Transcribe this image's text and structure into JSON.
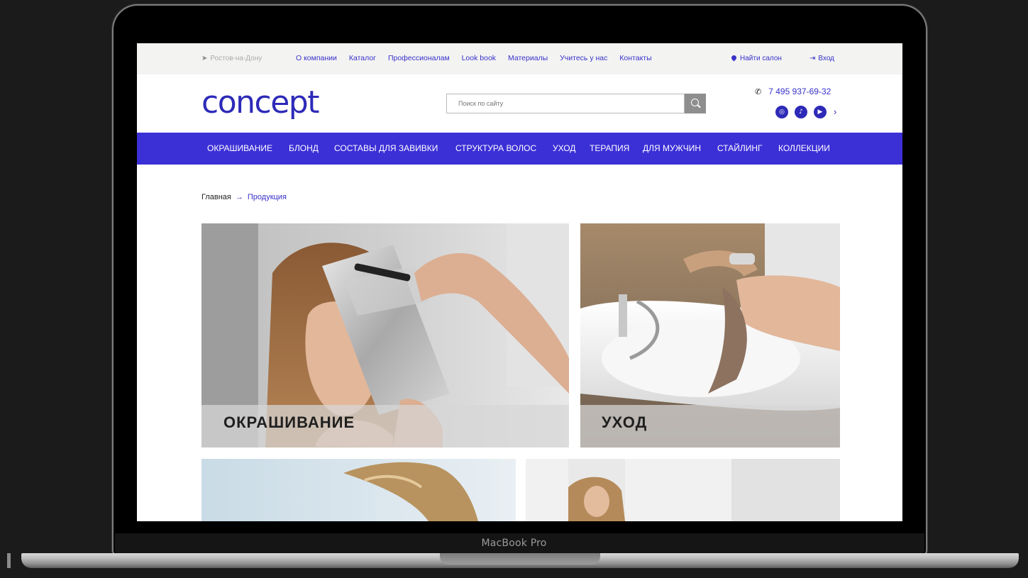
{
  "device": {
    "model": "MacBook Pro"
  },
  "topbar": {
    "city": "Ростов-на-Дону",
    "links": [
      "О компании",
      "Каталог",
      "Профессионалам",
      "Look book",
      "Материалы",
      "Учитесь у нас",
      "Контакты"
    ],
    "find_salon": "Найти салон",
    "login": "Вход"
  },
  "header": {
    "logo": "concept",
    "search_placeholder": "Поиск по сайту",
    "phone": "7 495 937-69-32",
    "socials": [
      "instagram-icon",
      "tiktok-icon",
      "youtube-icon"
    ]
  },
  "catnav": {
    "items": [
      "ОКРАШИВАНИЕ",
      "БЛОНД",
      "СОСТАВЫ ДЛЯ ЗАВИВКИ",
      "СТРУКТУРА ВОЛОС",
      "УХОД",
      "ТЕРАПИЯ",
      "ДЛЯ МУЖЧИН",
      "СТАЙЛИНГ",
      "КОЛЛЕКЦИИ"
    ]
  },
  "breadcrumb": {
    "home": "Главная",
    "current": "Продукция"
  },
  "tiles": [
    {
      "label": "ОКРАШИВАНИЕ"
    },
    {
      "label": "УХОД"
    },
    {
      "label": ""
    },
    {
      "label": ""
    }
  ],
  "colors": {
    "brand": "#3b2fd6",
    "link": "#3730c8",
    "logo": "#2e2ab8"
  }
}
